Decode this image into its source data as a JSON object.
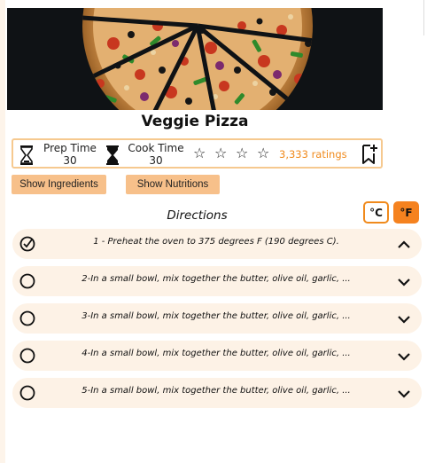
{
  "recipe": {
    "title": "Veggie Pizza",
    "prep_label": "Prep Time",
    "prep_value": "30",
    "cook_label": "Cook Time",
    "cook_value": "30",
    "rating_stars_filled": 0,
    "rating_stars_total": 4,
    "ratings_text": "3,333 ratings",
    "bookmark_icon": "bookmark-add-icon",
    "hourglass_icon": "hourglass-icon"
  },
  "buttons": {
    "show_ingredients": "Show Ingredients",
    "show_nutritions": "Show Nutritions"
  },
  "directions": {
    "title": "Directions",
    "unit_c": "°C",
    "unit_f": "°F",
    "active_unit": "F",
    "steps": [
      {
        "text": "1 - Preheat the oven to 375 degrees F (190 degrees C).",
        "checked": true,
        "expanded": true
      },
      {
        "text": "2-In a small bowl, mix together the butter, olive oil, garlic, ...",
        "checked": false,
        "expanded": false
      },
      {
        "text": "3-In a small bowl, mix together the butter, olive oil, garlic, ...",
        "checked": false,
        "expanded": false
      },
      {
        "text": "4-In a small bowl, mix together the butter, olive oil, garlic, ...",
        "checked": false,
        "expanded": false
      },
      {
        "text": "5-In a small bowl, mix together the butter, olive oil, garlic, ...",
        "checked": false,
        "expanded": false
      }
    ]
  },
  "colors": {
    "accent": "#f5821f",
    "button_bg": "#f7c08a",
    "step_bg": "#fdf2e6",
    "info_border": "#f6c98f"
  }
}
